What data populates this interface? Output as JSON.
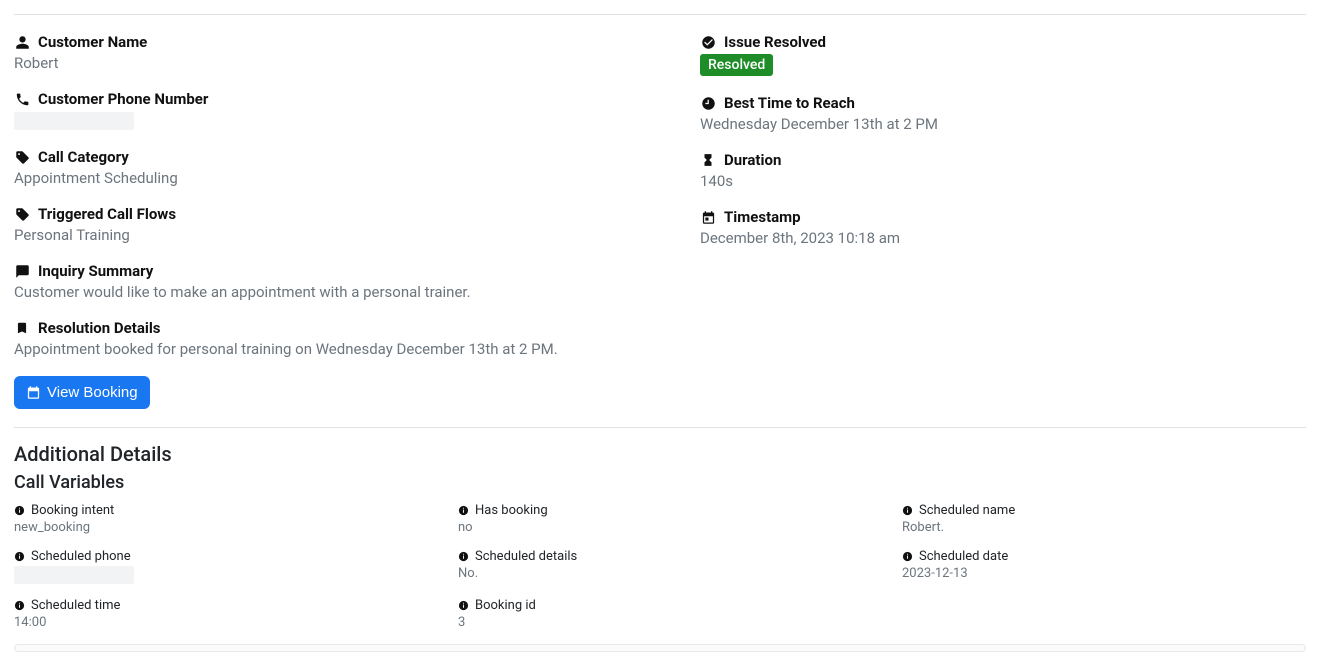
{
  "left": {
    "customer_name": {
      "label": "Customer Name",
      "value": "Robert"
    },
    "customer_phone": {
      "label": "Customer Phone Number",
      "value": ""
    },
    "call_category": {
      "label": "Call Category",
      "value": "Appointment Scheduling"
    },
    "triggered_flows": {
      "label": "Triggered Call Flows",
      "value": "Personal Training"
    },
    "inquiry_summary": {
      "label": "Inquiry Summary",
      "value": "Customer would like to make an appointment with a personal trainer."
    },
    "resolution_details": {
      "label": "Resolution Details",
      "value": "Appointment booked for personal training on Wednesday December 13th at 2 PM."
    }
  },
  "right": {
    "issue_resolved": {
      "label": "Issue Resolved",
      "badge": "Resolved"
    },
    "best_time": {
      "label": "Best Time to Reach",
      "value": "Wednesday December 13th at 2 PM"
    },
    "duration": {
      "label": "Duration",
      "value": "140s"
    },
    "timestamp": {
      "label": "Timestamp",
      "value": "December 8th, 2023 10:18 am"
    }
  },
  "actions": {
    "view_booking": "View Booking"
  },
  "additional": {
    "section_title": "Additional Details",
    "sub_title": "Call Variables",
    "vars": [
      {
        "label": "Booking intent",
        "value": "new_booking"
      },
      {
        "label": "Has booking",
        "value": "no"
      },
      {
        "label": "Scheduled name",
        "value": "Robert."
      },
      {
        "label": "Scheduled phone",
        "value": ""
      },
      {
        "label": "Scheduled details",
        "value": "No."
      },
      {
        "label": "Scheduled date",
        "value": "2023-12-13"
      },
      {
        "label": "Scheduled time",
        "value": "14:00"
      },
      {
        "label": "Booking id",
        "value": "3"
      }
    ]
  }
}
